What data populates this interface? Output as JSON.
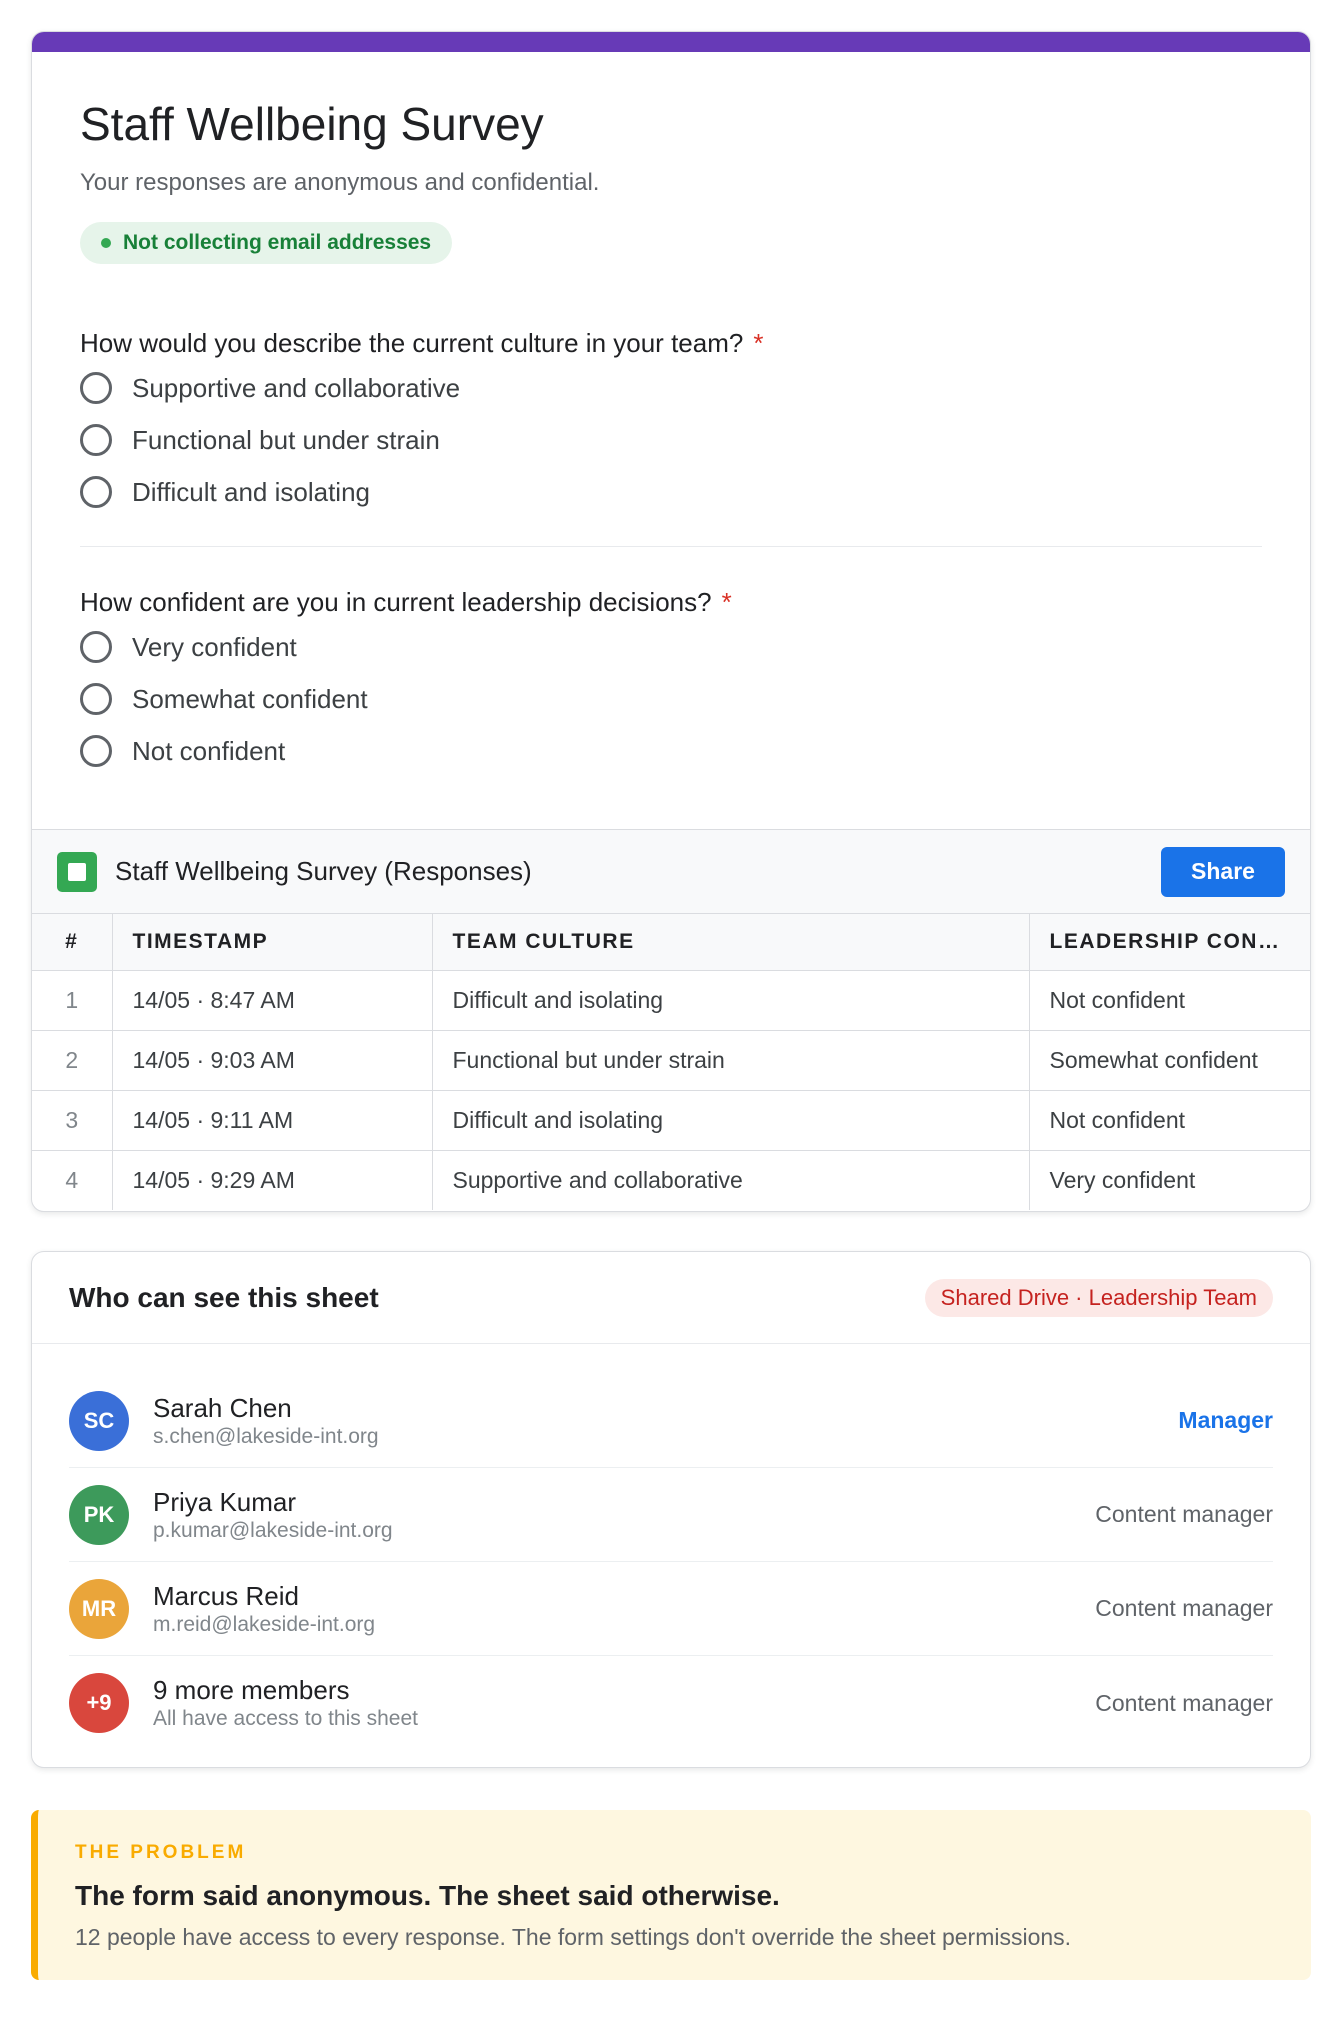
{
  "form": {
    "title": "Staff Wellbeing Survey",
    "description": "Your responses are anonymous and confidential.",
    "email_status": "Not collecting email addresses",
    "accent_color": "#673ab7",
    "questions": [
      {
        "title": "How would you describe the current culture in your team?",
        "required_mark": "*",
        "options": [
          "Supportive and collaborative",
          "Functional but under strain",
          "Difficult and isolating"
        ]
      },
      {
        "title": "How confident are you in current leadership decisions?",
        "required_mark": "*",
        "options": [
          "Very confident",
          "Somewhat confident",
          "Not confident"
        ]
      }
    ]
  },
  "sheet": {
    "title": "Staff Wellbeing Survey (Responses)",
    "share_label": "Share",
    "columns": [
      "#",
      "TIMESTAMP",
      "TEAM CULTURE",
      "LEADERSHIP CON…"
    ],
    "rows": [
      [
        "1",
        "14/05 · 8:47 AM",
        "Difficult and isolating",
        "Not confident"
      ],
      [
        "2",
        "14/05 · 9:03 AM",
        "Functional but under strain",
        "Somewhat confident"
      ],
      [
        "3",
        "14/05 · 9:11 AM",
        "Difficult and isolating",
        "Not confident"
      ],
      [
        "4",
        "14/05 · 9:29 AM",
        "Supportive and collaborative",
        "Very confident"
      ]
    ]
  },
  "access": {
    "title": "Who can see this sheet",
    "drive_badge": "Shared Drive · Leadership Team",
    "members": [
      {
        "initials": "SC",
        "name": "Sarah Chen",
        "email": "s.chen@lakeside-int.org",
        "role": "Manager",
        "color": "#3a6fd8"
      },
      {
        "initials": "PK",
        "name": "Priya Kumar",
        "email": "p.kumar@lakeside-int.org",
        "role": "Content manager",
        "color": "#3d9a5b"
      },
      {
        "initials": "MR",
        "name": "Marcus Reid",
        "email": "m.reid@lakeside-int.org",
        "role": "Content manager",
        "color": "#eaa53a"
      },
      {
        "initials": "+9",
        "name": "9 more members",
        "email": "All have access to this sheet",
        "role": "Content manager",
        "color": "#d9473d"
      }
    ]
  },
  "problem": {
    "kicker": "THE PROBLEM",
    "headline": "The form said anonymous. The sheet said otherwise.",
    "body": "12 people have access to every response. The form settings don't override the sheet permissions."
  }
}
